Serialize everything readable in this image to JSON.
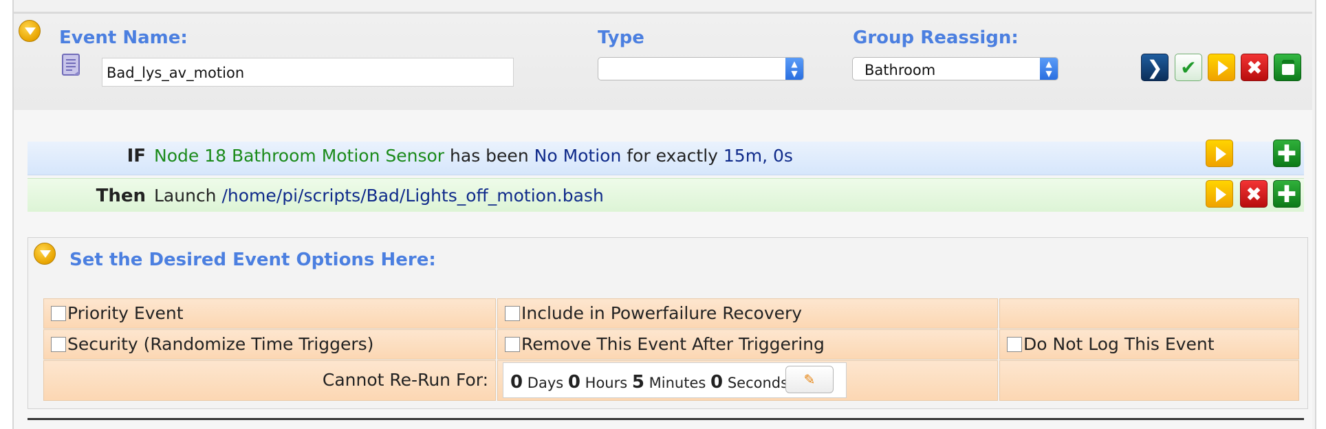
{
  "event": {
    "name_label": "Event Name:",
    "name_value": "Bad_lys_av_motion",
    "type_label": "Type",
    "type_value": "",
    "group_label": "Group Reassign:",
    "group_value": "Bathroom"
  },
  "toolbar": {
    "go_glyph": "❯",
    "ok_glyph": "✔",
    "delete_glyph": "✖",
    "icons": [
      "chevron-right-icon",
      "checkmark-icon",
      "play-icon",
      "delete-icon",
      "copy-icon"
    ]
  },
  "trigger": {
    "keyword": "IF",
    "device": "Node 18 Bathroom Motion Sensor",
    "verb": "has been",
    "state": "No Motion",
    "duration_text": "for exactly",
    "duration": "15m, 0s"
  },
  "action": {
    "keyword": "Then",
    "verb": "Launch",
    "path": "/home/pi/scripts/Bad/Lights_off_motion.bash"
  },
  "row_buttons": {
    "add_glyph": "✚",
    "delete_glyph": "✖"
  },
  "options": {
    "title": "Set the Desired Event Options Here:",
    "priority": "Priority Event",
    "powerfail": "Include in Powerfailure Recovery",
    "security": "Security (Randomize Time Triggers)",
    "remove": "Remove This Event After Triggering",
    "nolog": "Do Not Log This Event",
    "rerun_label": "Cannot Re-Run For:",
    "rerun": {
      "days": "0",
      "days_label": "Days",
      "hours": "0",
      "hours_label": "Hours",
      "minutes": "5",
      "minutes_label": "Minutes",
      "seconds": "0",
      "seconds_label": "Seconds"
    },
    "edit_glyph": "✎",
    "checked": {
      "priority": false,
      "powerfail": false,
      "security": false,
      "remove": false,
      "nolog": false
    }
  },
  "colors": {
    "label_blue": "#4b7fe0",
    "device_green": "#1a8a1a",
    "value_navy": "#0f2a8a",
    "option_orange": "#fcd7b3"
  }
}
